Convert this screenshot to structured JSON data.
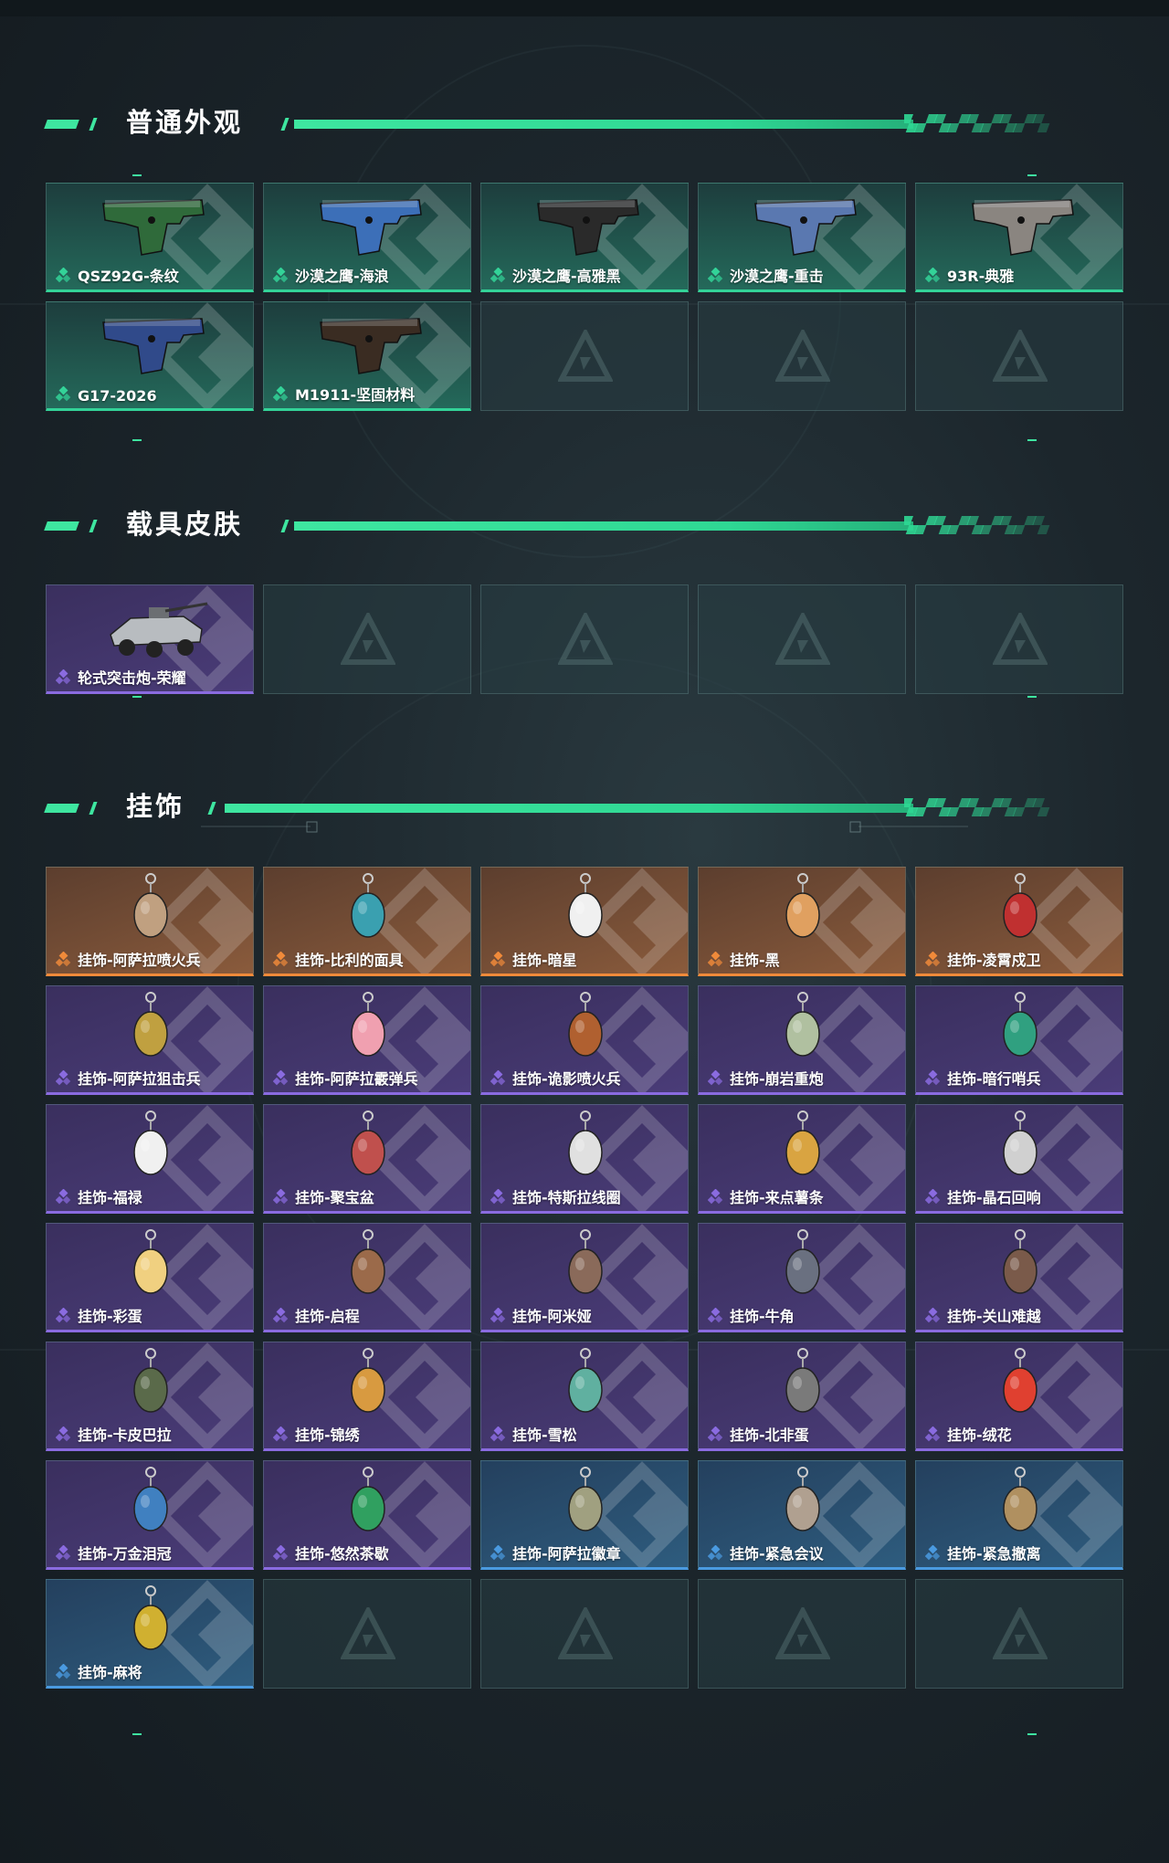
{
  "colors": {
    "accent": "#3ee6a0",
    "rarity_green": "#33d398",
    "rarity_purple": "#8a6be0",
    "rarity_orange": "#f08a3a",
    "rarity_blue": "#4a9ae0"
  },
  "sections": [
    {
      "title": "普通外观",
      "items": [
        {
          "label": "QSZ92G-条纹",
          "rarity": "green",
          "icon": "pistol-icon"
        },
        {
          "label": "沙漠之鹰-海浪",
          "rarity": "green",
          "icon": "pistol-icon"
        },
        {
          "label": "沙漠之鹰-高雅黑",
          "rarity": "green",
          "icon": "pistol-icon"
        },
        {
          "label": "沙漠之鹰-重击",
          "rarity": "green",
          "icon": "pistol-icon"
        },
        {
          "label": "93R-典雅",
          "rarity": "green",
          "icon": "pistol-icon"
        },
        {
          "label": "G17-2026",
          "rarity": "green",
          "icon": "pistol-icon"
        },
        {
          "label": "M1911-坚固材料",
          "rarity": "green",
          "icon": "pistol-icon"
        },
        {
          "label": "",
          "rarity": "empty"
        },
        {
          "label": "",
          "rarity": "empty"
        },
        {
          "label": "",
          "rarity": "empty"
        }
      ]
    },
    {
      "title": "载具皮肤",
      "items": [
        {
          "label": "轮式突击炮-荣耀",
          "rarity": "purple",
          "icon": "vehicle-icon"
        },
        {
          "label": "",
          "rarity": "empty"
        },
        {
          "label": "",
          "rarity": "empty"
        },
        {
          "label": "",
          "rarity": "empty"
        },
        {
          "label": "",
          "rarity": "empty"
        }
      ]
    },
    {
      "title": "挂饰",
      "items": [
        {
          "label": "挂饰-阿萨拉喷火兵",
          "rarity": "orange",
          "icon": "charm-icon"
        },
        {
          "label": "挂饰-比利的面具",
          "rarity": "orange",
          "icon": "charm-icon"
        },
        {
          "label": "挂饰-暗星",
          "rarity": "orange",
          "icon": "charm-icon"
        },
        {
          "label": "挂饰-黑",
          "rarity": "orange",
          "icon": "charm-icon"
        },
        {
          "label": "挂饰-凌霄戍卫",
          "rarity": "orange",
          "icon": "charm-icon"
        },
        {
          "label": "挂饰-阿萨拉狙击兵",
          "rarity": "purple",
          "icon": "charm-icon"
        },
        {
          "label": "挂饰-阿萨拉霰弹兵",
          "rarity": "purple",
          "icon": "charm-icon"
        },
        {
          "label": "挂饰-诡影喷火兵",
          "rarity": "purple",
          "icon": "charm-icon"
        },
        {
          "label": "挂饰-崩岩重炮",
          "rarity": "purple",
          "icon": "charm-icon"
        },
        {
          "label": "挂饰-暗行哨兵",
          "rarity": "purple",
          "icon": "charm-icon"
        },
        {
          "label": "挂饰-福禄",
          "rarity": "purple",
          "icon": "charm-icon"
        },
        {
          "label": "挂饰-聚宝盆",
          "rarity": "purple",
          "icon": "charm-icon"
        },
        {
          "label": "挂饰-特斯拉线圈",
          "rarity": "purple",
          "icon": "charm-icon"
        },
        {
          "label": "挂饰-来点薯条",
          "rarity": "purple",
          "icon": "charm-icon"
        },
        {
          "label": "挂饰-晶石回响",
          "rarity": "purple",
          "icon": "charm-icon"
        },
        {
          "label": "挂饰-彩蛋",
          "rarity": "purple",
          "icon": "charm-icon"
        },
        {
          "label": "挂饰-启程",
          "rarity": "purple",
          "icon": "charm-icon"
        },
        {
          "label": "挂饰-阿米娅",
          "rarity": "purple",
          "icon": "charm-icon"
        },
        {
          "label": "挂饰-牛角",
          "rarity": "purple",
          "icon": "charm-icon"
        },
        {
          "label": "挂饰-关山难越",
          "rarity": "purple",
          "icon": "charm-icon"
        },
        {
          "label": "挂饰-卡皮巴拉",
          "rarity": "purple",
          "icon": "charm-icon"
        },
        {
          "label": "挂饰-锦绣",
          "rarity": "purple",
          "icon": "charm-icon"
        },
        {
          "label": "挂饰-雪松",
          "rarity": "purple",
          "icon": "charm-icon"
        },
        {
          "label": "挂饰-北非蛋",
          "rarity": "purple",
          "icon": "charm-icon"
        },
        {
          "label": "挂饰-绒花",
          "rarity": "purple",
          "icon": "charm-icon"
        },
        {
          "label": "挂饰-万金泪冠",
          "rarity": "purple",
          "icon": "charm-icon"
        },
        {
          "label": "挂饰-悠然茶歇",
          "rarity": "purple",
          "icon": "charm-icon"
        },
        {
          "label": "挂饰-阿萨拉徽章",
          "rarity": "blue",
          "icon": "charm-icon"
        },
        {
          "label": "挂饰-紧急会议",
          "rarity": "blue",
          "icon": "charm-icon"
        },
        {
          "label": "挂饰-紧急撤离",
          "rarity": "blue",
          "icon": "charm-icon"
        },
        {
          "label": "挂饰-麻将",
          "rarity": "blue",
          "icon": "charm-icon"
        },
        {
          "label": "",
          "rarity": "empty"
        },
        {
          "label": "",
          "rarity": "empty"
        },
        {
          "label": "",
          "rarity": "empty"
        },
        {
          "label": "",
          "rarity": "empty"
        }
      ]
    }
  ]
}
